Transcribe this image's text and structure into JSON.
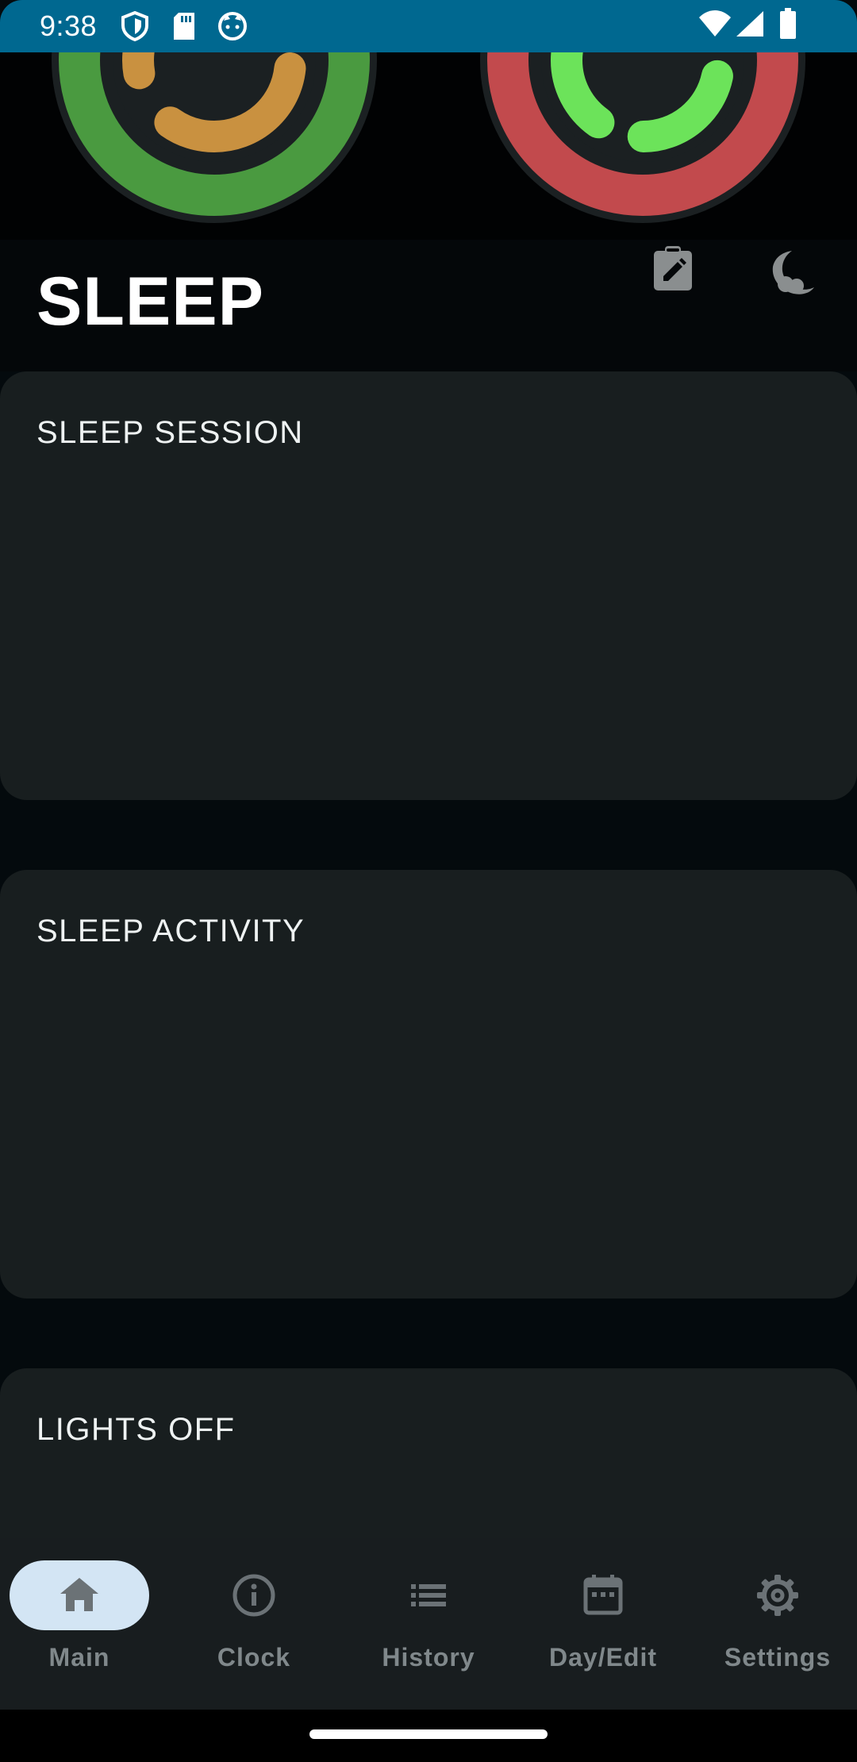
{
  "status_bar": {
    "time": "9:38",
    "icons": [
      "shield-icon",
      "sd-card-icon",
      "cat-face-icon",
      "wifi-icon",
      "signal-icon",
      "battery-icon"
    ],
    "background": "#006890"
  },
  "rings": [
    {
      "outer_color": "#4a9a40",
      "inner_color": "#c99140"
    },
    {
      "outer_color": "#c24a4d",
      "inner_color": "#6ce35a"
    }
  ],
  "header": {
    "title": "SLEEP",
    "buttons": [
      "edit-clipboard-icon",
      "sleep-moon-icon"
    ]
  },
  "cards": [
    {
      "title": "SLEEP SESSION"
    },
    {
      "title": "SLEEP ACTIVITY"
    },
    {
      "title": "LIGHTS OFF"
    }
  ],
  "bottom_nav": {
    "items": [
      {
        "label": "Main",
        "icon": "home-icon",
        "active": true
      },
      {
        "label": "Clock",
        "icon": "info-icon",
        "active": false
      },
      {
        "label": "History",
        "icon": "list-icon",
        "active": false
      },
      {
        "label": "Day/Edit",
        "icon": "calendar-icon",
        "active": false
      },
      {
        "label": "Settings",
        "icon": "gear-icon",
        "active": false
      }
    ],
    "active_pill_color": "#d3e5f4"
  }
}
